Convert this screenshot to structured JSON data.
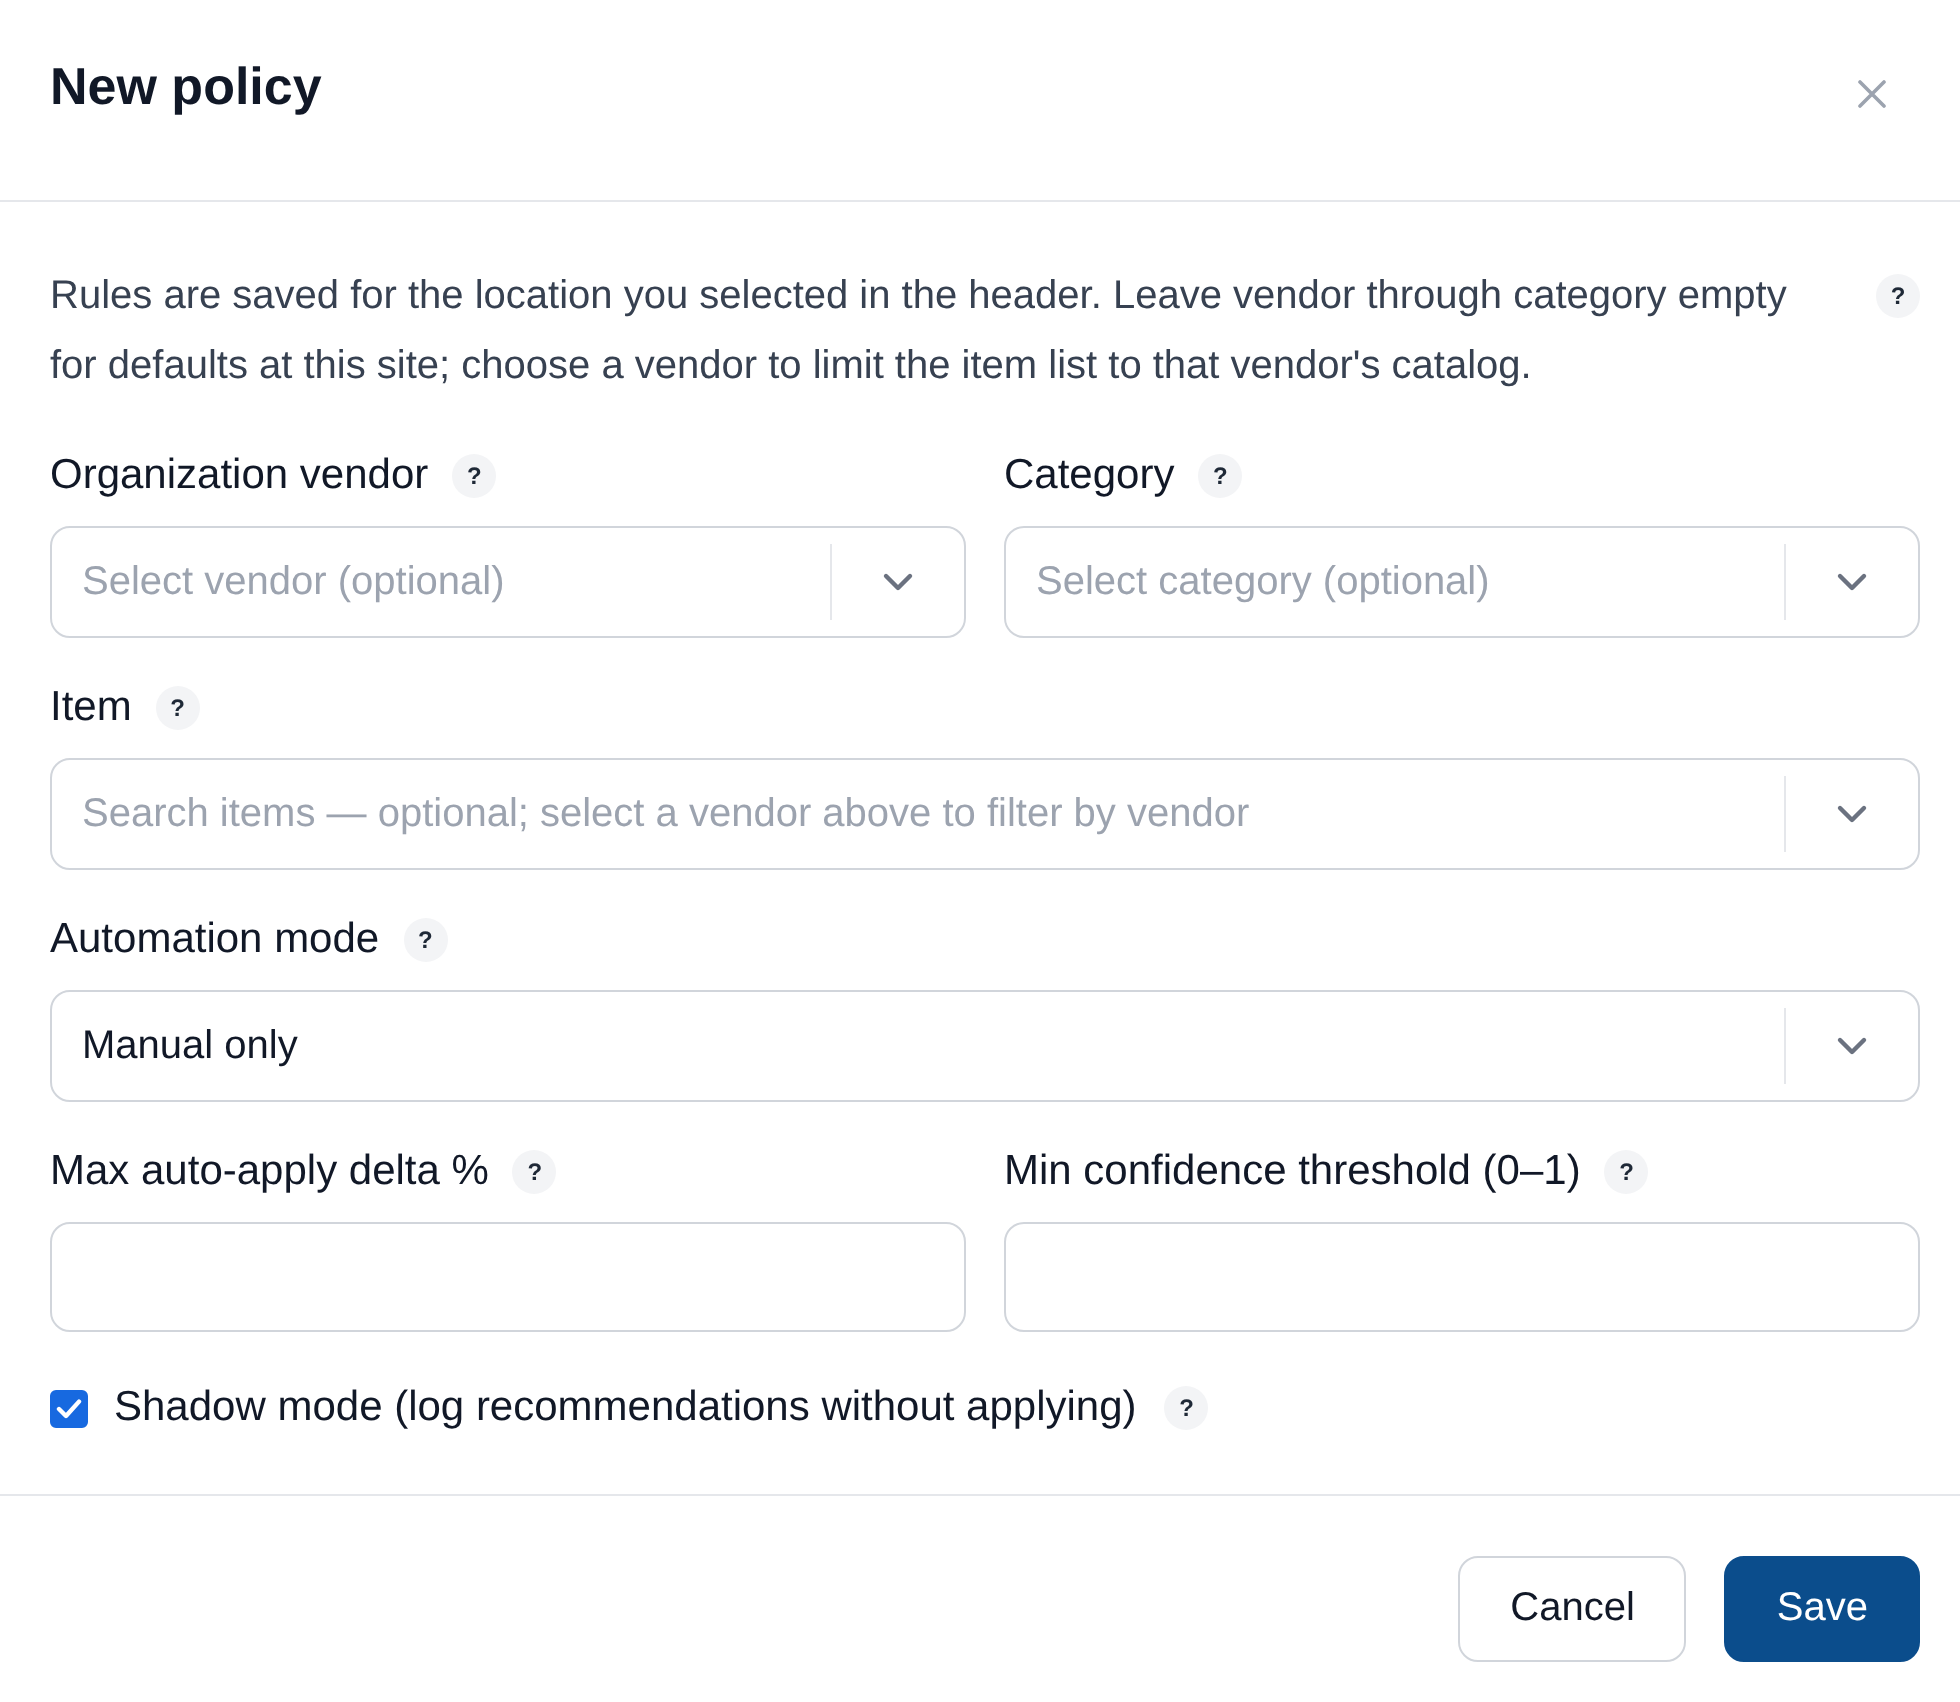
{
  "dialog": {
    "title": "New policy"
  },
  "intro": {
    "text": "Rules are saved for the location you selected in the header. Leave vendor through category empty for defaults at this site; choose a vendor to limit the item list to that vendor's catalog.",
    "help": "?"
  },
  "rows": [
    [
      {
        "kind": "select",
        "label": "Organization vendor",
        "help": "?",
        "placeholder": "Select vendor (optional)"
      },
      {
        "kind": "select",
        "label": "Category",
        "help": "?",
        "placeholder": "Select category (optional)"
      }
    ],
    [
      {
        "kind": "select",
        "label": "Item",
        "help": "?",
        "placeholder": "Search items — optional; select a vendor above to filter by vendor"
      }
    ],
    [
      {
        "kind": "select",
        "label": "Automation mode",
        "help": "?",
        "value": "Manual only"
      }
    ],
    [
      {
        "kind": "input",
        "label": "Max auto-apply delta %",
        "help": "?"
      },
      {
        "kind": "input",
        "label": "Min confidence threshold (0–1)",
        "help": "?"
      }
    ]
  ],
  "shadow_mode": {
    "label": "Shadow mode (log recommendations without applying)",
    "checked": true,
    "help": "?"
  },
  "footer": {
    "buttons": [
      {
        "label": "Cancel",
        "kind": "secondary"
      },
      {
        "label": "Save",
        "kind": "primary"
      }
    ]
  }
}
